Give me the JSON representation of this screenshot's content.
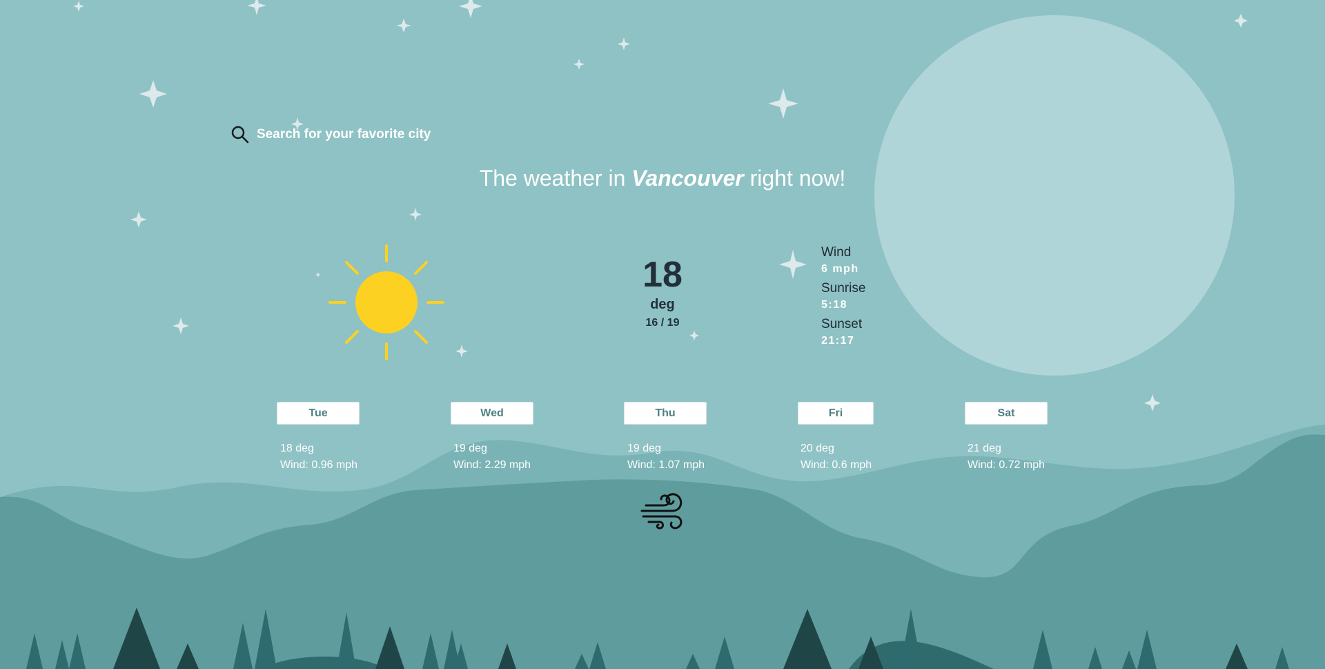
{
  "search": {
    "placeholder": "Search for your favorite city",
    "icon": "search-icon"
  },
  "headline": {
    "prefix": "The weather in ",
    "city": "Vancouver",
    "suffix": " right now!"
  },
  "current": {
    "condition_icon": "sun-icon",
    "temperature": "18",
    "unit": "deg",
    "range": "16 / 19",
    "wind_label": "Wind",
    "wind_value": "6 mph",
    "sunrise_label": "Sunrise",
    "sunrise_value": "5:18",
    "sunset_label": "Sunset",
    "sunset_value": "21:17"
  },
  "forecast": [
    {
      "day": "Tue",
      "temp": "18 deg",
      "wind": "Wind: 0.96 mph"
    },
    {
      "day": "Wed",
      "temp": "19 deg",
      "wind": "Wind: 2.29 mph"
    },
    {
      "day": "Thu",
      "temp": "19 deg",
      "wind": "Wind: 1.07 mph"
    },
    {
      "day": "Fri",
      "temp": "20 deg",
      "wind": "Wind: 0.6 mph"
    },
    {
      "day": "Sat",
      "temp": "21 deg",
      "wind": "Wind: 0.72 mph"
    }
  ],
  "selected_day_icon": "wind-icon",
  "colors": {
    "sky": "#8fc2c4",
    "moon": "#b0d5d8",
    "sun": "#fcd122",
    "hills_far": "#7ab3b5",
    "hills_near": "#5f9c9e",
    "trees": "#1f4547",
    "button_text": "#4f7f82"
  }
}
